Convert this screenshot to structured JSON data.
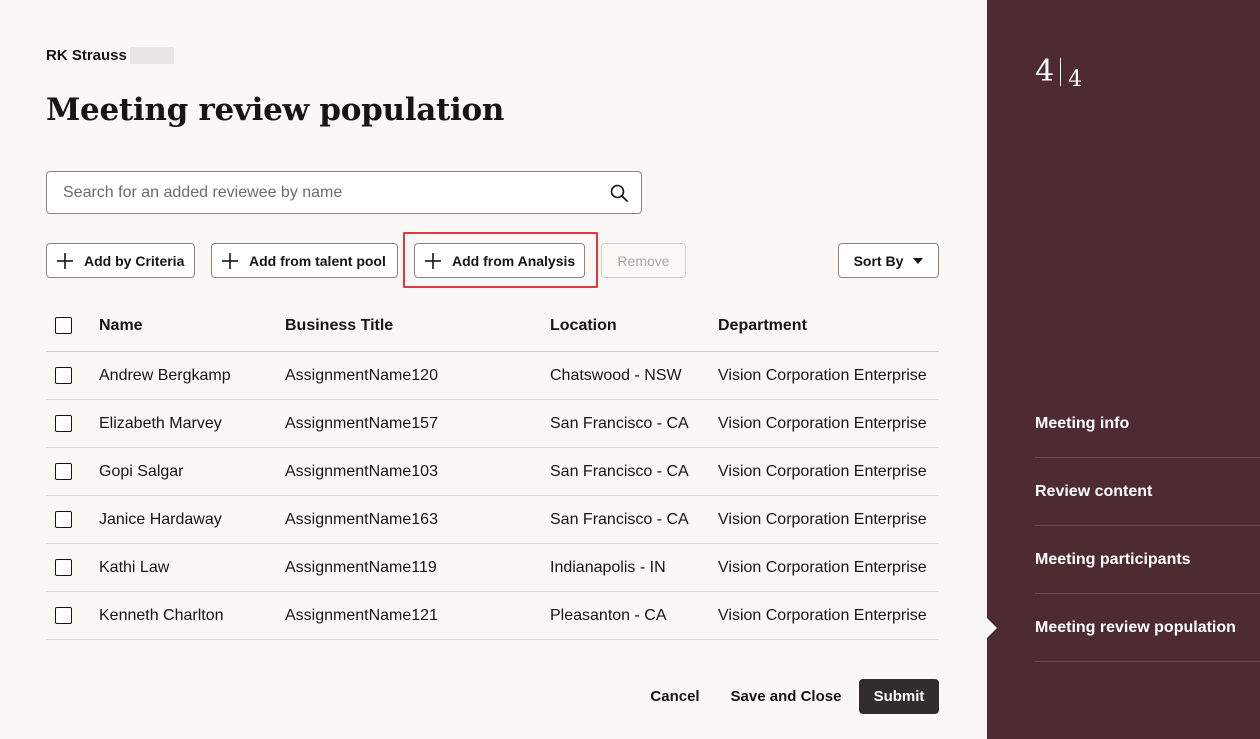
{
  "header": {
    "owner": "RK Strauss",
    "title": "Meeting review population"
  },
  "search": {
    "placeholder": "Search for an added reviewee by name"
  },
  "toolbar": {
    "add_by_criteria": "Add by Criteria",
    "add_from_talent_pool": "Add from talent pool",
    "add_from_analysis": "Add from Analysis",
    "remove": "Remove",
    "sort_by": "Sort By"
  },
  "table": {
    "columns": [
      "Name",
      "Business Title",
      "Location",
      "Department"
    ],
    "rows": [
      {
        "name": "Andrew Bergkamp",
        "title": "AssignmentName120",
        "location": "Chatswood - NSW",
        "department": "Vision Corporation Enterprise"
      },
      {
        "name": "Elizabeth Marvey",
        "title": "AssignmentName157",
        "location": "San Francisco - CA",
        "department": "Vision Corporation Enterprise"
      },
      {
        "name": "Gopi Salgar",
        "title": "AssignmentName103",
        "location": "San Francisco - CA",
        "department": "Vision Corporation Enterprise"
      },
      {
        "name": "Janice Hardaway",
        "title": "AssignmentName163",
        "location": "San Francisco - CA",
        "department": "Vision Corporation Enterprise"
      },
      {
        "name": "Kathi Law",
        "title": "AssignmentName119",
        "location": "Indianapolis - IN",
        "department": "Vision Corporation Enterprise"
      },
      {
        "name": "Kenneth Charlton",
        "title": "AssignmentName121",
        "location": "Pleasanton - CA",
        "department": "Vision Corporation Enterprise"
      }
    ]
  },
  "footer": {
    "cancel": "Cancel",
    "save_and_close": "Save and Close",
    "submit": "Submit"
  },
  "steps": {
    "current": "4",
    "total": "4",
    "items": [
      "Meeting info",
      "Review content",
      "Meeting participants",
      "Meeting review population"
    ],
    "active_index": 3
  },
  "colors": {
    "sidebar": "#4e2a31",
    "highlight": "#e03a3e",
    "primary_button": "#312d2a"
  }
}
